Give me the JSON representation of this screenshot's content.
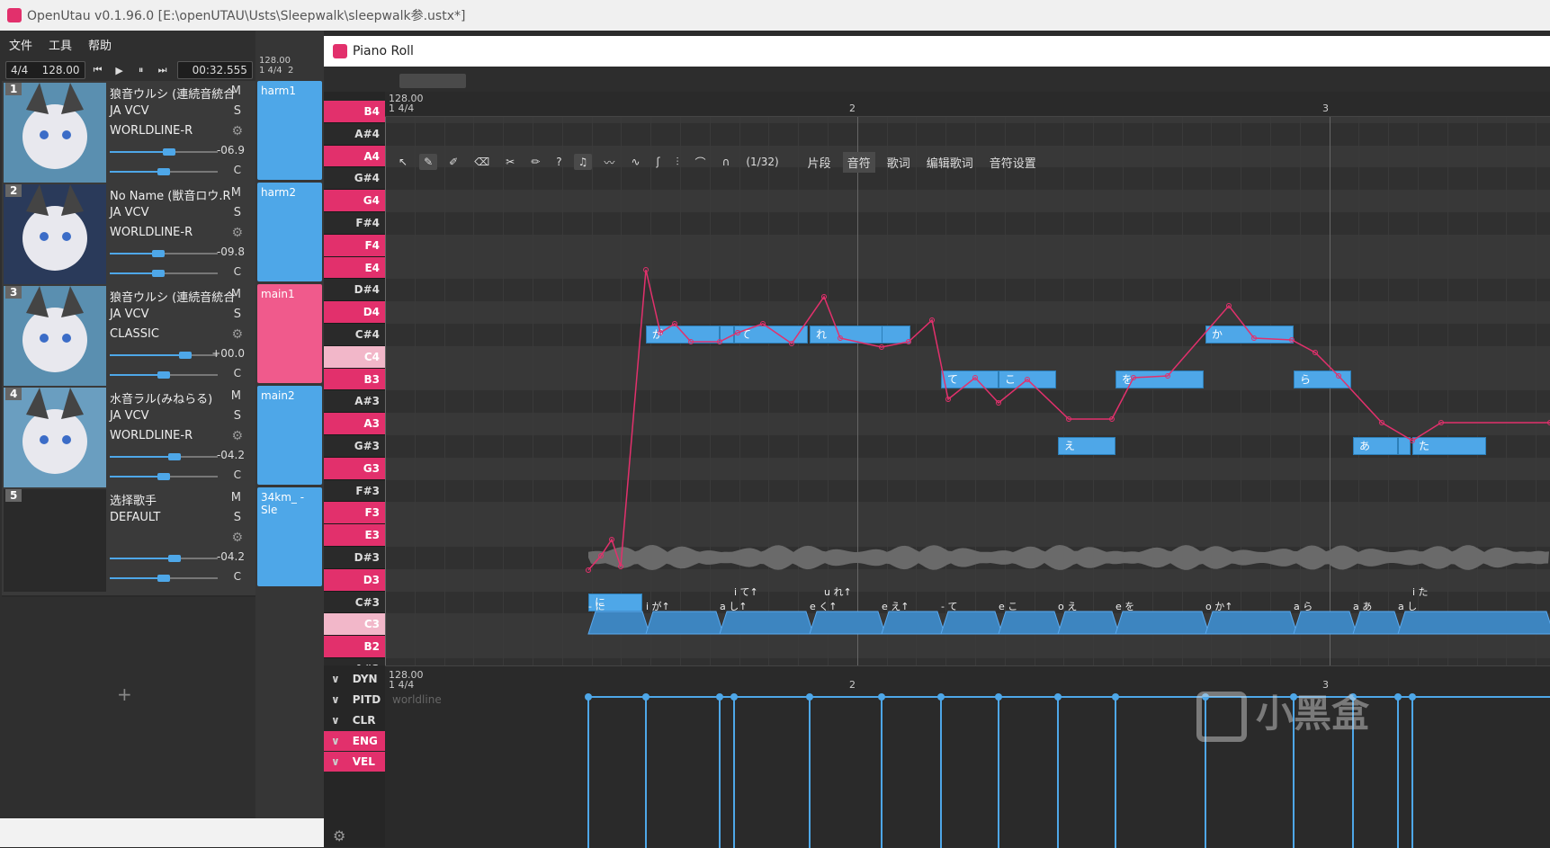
{
  "window": {
    "title": "OpenUtau v0.1.96.0 [E:\\openUTAU\\Usts\\Sleepwalk\\sleepwalk参.ustx*]"
  },
  "menu": [
    "文件",
    "工具",
    "帮助"
  ],
  "transport": {
    "time_sig": "4/4",
    "bpm": "128.00",
    "time": "00:32.555"
  },
  "timeline_header": {
    "bpm": "128.00",
    "sig": "1 4/4",
    "bar2": "2"
  },
  "tracks": [
    {
      "num": "1",
      "name": "狼音ウルシ (連続音統合",
      "phonemizer": "JA VCV",
      "renderer": "WORLDLINE-R",
      "m": "M",
      "s": "S",
      "volume": "-06.9",
      "pan": "C",
      "vol_level": 0.55,
      "pan_level": 0.5
    },
    {
      "num": "2",
      "name": "No Name (獣音ロウ.R",
      "phonemizer": "JA VCV",
      "renderer": "WORLDLINE-R",
      "m": "M",
      "s": "S",
      "volume": "-09.8",
      "pan": "C",
      "vol_level": 0.45,
      "pan_level": 0.45
    },
    {
      "num": "3",
      "name": "狼音ウルシ (連続音統合",
      "phonemizer": "JA VCV",
      "renderer": "CLASSIC",
      "m": "M",
      "s": "S",
      "volume": "+00.0",
      "pan": "C",
      "vol_level": 0.7,
      "pan_level": 0.5
    },
    {
      "num": "4",
      "name": "水音ラル(みねらる)",
      "phonemizer": "JA VCV",
      "renderer": "WORLDLINE-R",
      "m": "M",
      "s": "S",
      "volume": "-04.2",
      "pan": "C",
      "vol_level": 0.6,
      "pan_level": 0.5
    },
    {
      "num": "5",
      "name": "选择歌手",
      "phonemizer": "DEFAULT",
      "renderer": "",
      "m": "M",
      "s": "S",
      "volume": "-04.2",
      "pan": "C",
      "vol_level": 0.6,
      "pan_level": 0.5
    }
  ],
  "parts": [
    {
      "name": "harm1",
      "color": "#4ea7e8"
    },
    {
      "name": "harm2",
      "color": "#4ea7e8"
    },
    {
      "name": "main1",
      "color": "#f05a8c"
    },
    {
      "name": "main2",
      "color": "#4ea7e8"
    },
    {
      "name": "34km_ - Sle",
      "color": "#4ea7e8"
    }
  ],
  "add_track": "+",
  "piano_roll": {
    "title": "Piano Roll",
    "ruler": {
      "bpm": "128.00",
      "sig": "1 4/4",
      "bar2": "2",
      "bar3": "3"
    },
    "keys": [
      "B4",
      "A#4",
      "A4",
      "G#4",
      "G4",
      "F#4",
      "F4",
      "E4",
      "D#4",
      "D4",
      "C#4",
      "C4",
      "B3",
      "A#3",
      "A3",
      "G#3",
      "G3",
      "F#3",
      "F3",
      "E3",
      "D#3",
      "D3",
      "C#3",
      "C3",
      "B2",
      "A#2"
    ],
    "snap": "(1/32)",
    "tabs": [
      "片段",
      "音符",
      "歌词",
      "编辑歌词",
      "音符设置"
    ],
    "selected_tab": "音符",
    "notes": [
      {
        "lyric": "に",
        "key": "C#3"
      },
      {
        "lyric": "が",
        "key": "C#4"
      },
      {
        "lyric": "",
        "key": "C#4"
      },
      {
        "lyric": "て",
        "key": "C#4"
      },
      {
        "lyric": "れ",
        "key": "C#4"
      },
      {
        "lyric": "",
        "key": "C#4"
      },
      {
        "lyric": "て",
        "key": "B3"
      },
      {
        "lyric": "こ",
        "key": "B3"
      },
      {
        "lyric": "え",
        "key": "G#3"
      },
      {
        "lyric": "を",
        "key": "B3"
      },
      {
        "lyric": "か",
        "key": "C#4"
      },
      {
        "lyric": "ら",
        "key": "B3"
      },
      {
        "lyric": "あ",
        "key": "G#3"
      },
      {
        "lyric": "",
        "key": "G#3"
      },
      {
        "lyric": "た",
        "key": "G#3"
      }
    ],
    "phonemes_upper": [
      "i て↑",
      "u れ↑",
      "i た"
    ],
    "phonemes_lower": [
      "- に",
      "i が↑",
      "a し↑",
      "e く↑",
      "e え↑",
      "- て",
      "e こ",
      "o え",
      "e を",
      "o か↑",
      "a ら",
      "a あ",
      "a し"
    ]
  },
  "expressions": {
    "ruler": {
      "bpm": "128.00",
      "sig": "1 4/4",
      "bar2": "2",
      "bar3": "3"
    },
    "labels": [
      "DYN",
      "PITD",
      "CLR",
      "ENG",
      "VEL"
    ],
    "renderer_hint": "worldline"
  },
  "watermark": "小黑盒"
}
